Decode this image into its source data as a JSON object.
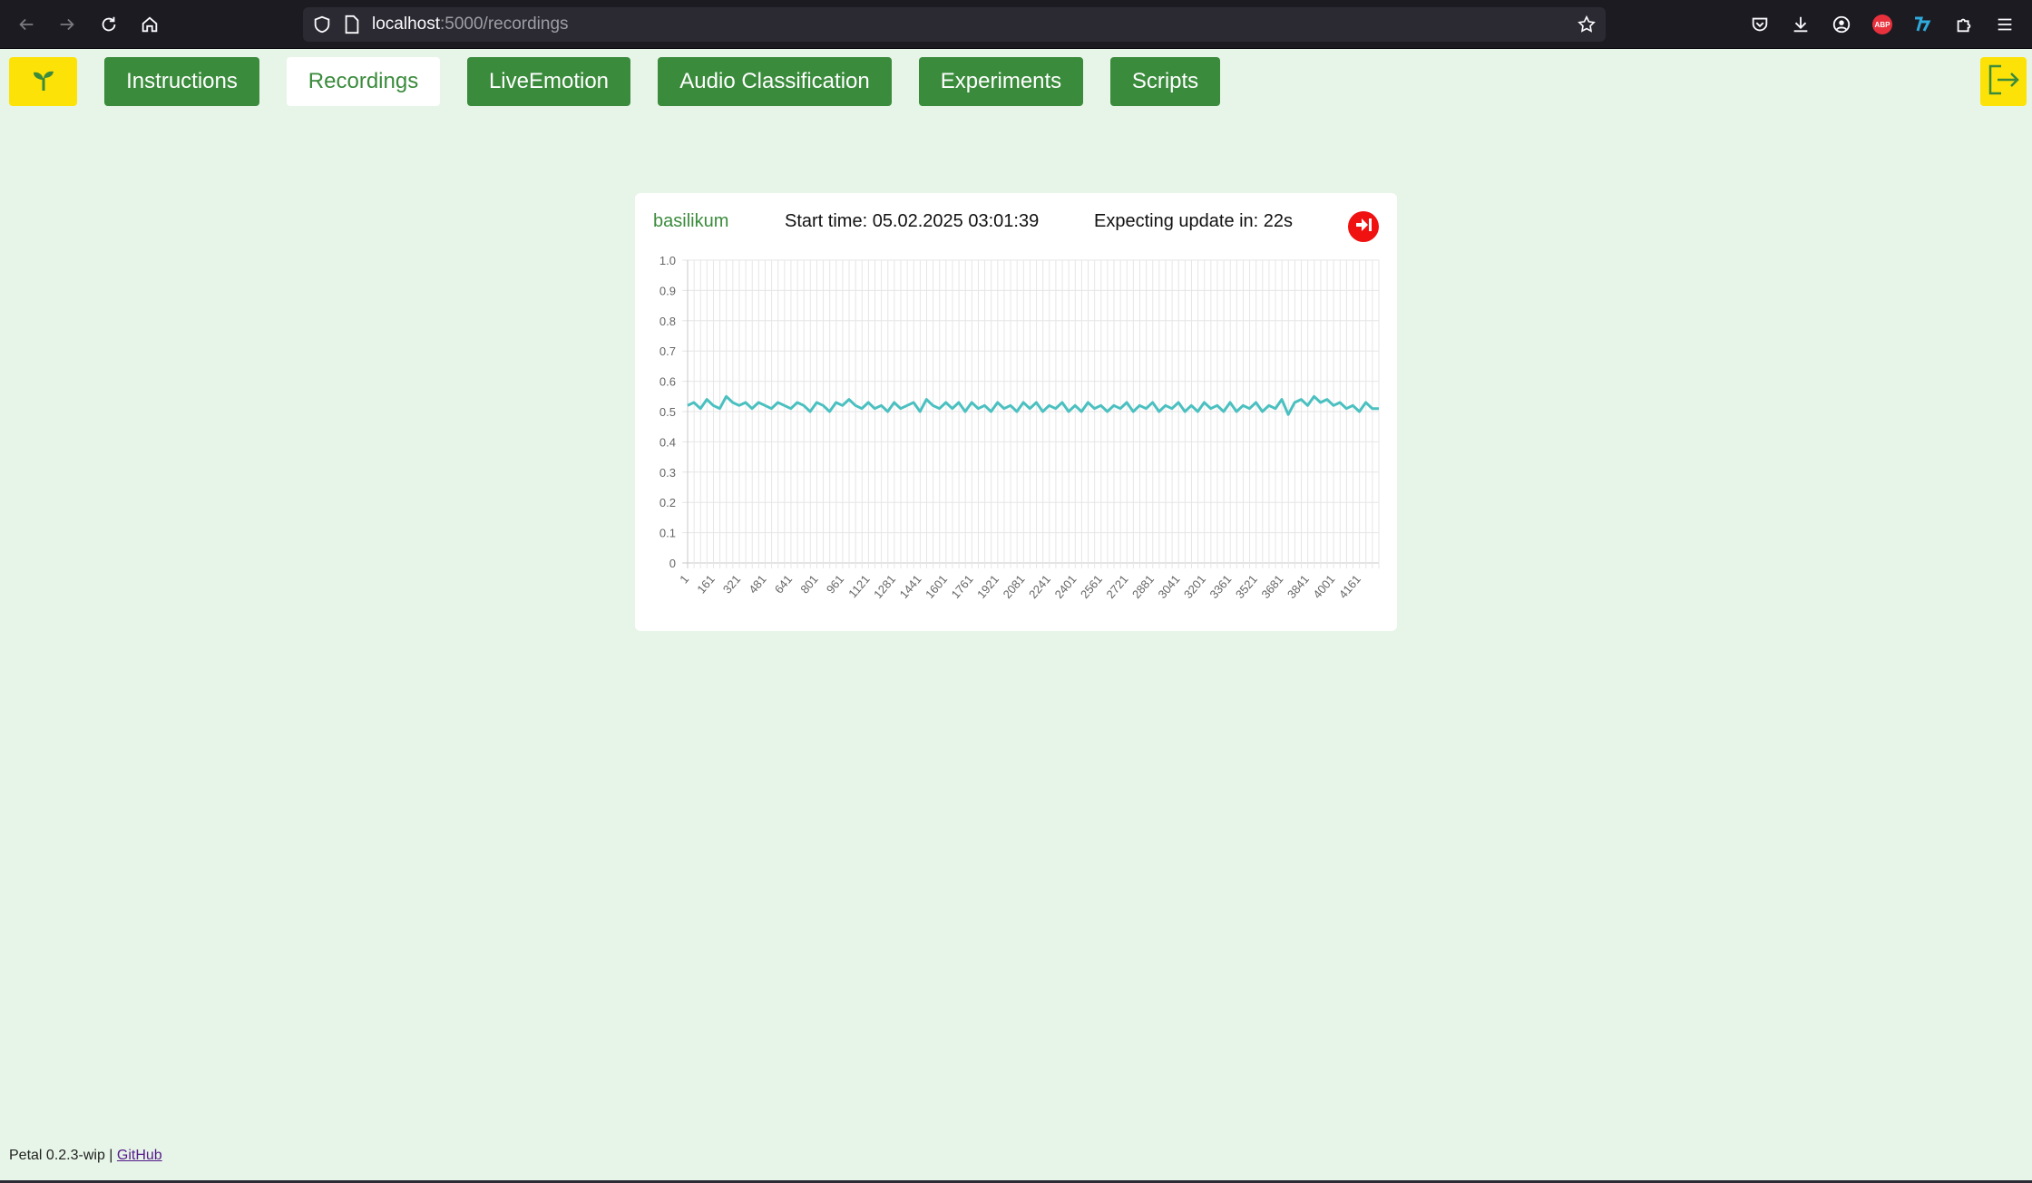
{
  "browser": {
    "url_host": "localhost",
    "url_rest": ":5000/recordings",
    "icons": [
      "back-arrow-icon",
      "forward-arrow-icon",
      "reload-icon",
      "home-icon",
      "shield-icon",
      "page-icon",
      "bookmark-star-icon",
      "pocket-icon",
      "download-icon",
      "account-icon",
      "adblock-icon",
      "extension-icon",
      "puzzle-icon",
      "menu-icon"
    ],
    "abp_label": "ABP"
  },
  "nav": {
    "home_icon": "sprout-icon",
    "tabs": [
      {
        "label": "Instructions",
        "active": false
      },
      {
        "label": "Recordings",
        "active": true
      },
      {
        "label": "LiveEmotion",
        "active": false
      },
      {
        "label": "Audio Classification",
        "active": false
      },
      {
        "label": "Experiments",
        "active": false
      },
      {
        "label": "Scripts",
        "active": false
      }
    ],
    "logout_icon": "logout-icon"
  },
  "recording": {
    "plant": "basilikum",
    "start_time": "Start time: 05.02.2025 03:01:39",
    "update": "Expecting update in: 22s",
    "stop_icon": "stop-recording-icon"
  },
  "chart_data": {
    "type": "line",
    "title": "",
    "xlabel": "",
    "ylabel": "",
    "ylim": [
      0,
      1.0
    ],
    "yticks": [
      "0",
      "0.1",
      "0.2",
      "0.3",
      "0.4",
      "0.5",
      "0.6",
      "0.7",
      "0.8",
      "0.9",
      "1.0"
    ],
    "xticks": [
      "1",
      "161",
      "321",
      "481",
      "641",
      "801",
      "961",
      "1121",
      "1281",
      "1441",
      "1601",
      "1761",
      "1921",
      "2081",
      "2241",
      "2401",
      "2561",
      "2721",
      "2881",
      "3041",
      "3201",
      "3361",
      "3521",
      "3681",
      "3841",
      "4001",
      "4161"
    ],
    "x_range": [
      1,
      4281
    ],
    "grid": true,
    "color": "#4bc0c0",
    "series": [
      {
        "x": [
          1,
          40,
          80,
          120,
          160,
          200,
          240,
          280,
          320,
          360,
          400,
          440,
          480,
          520,
          560,
          600,
          640,
          680,
          720,
          760,
          800,
          840,
          880,
          920,
          960,
          1000,
          1040,
          1080,
          1120,
          1160,
          1200,
          1240,
          1280,
          1320,
          1360,
          1400,
          1440,
          1480,
          1520,
          1560,
          1600,
          1640,
          1680,
          1720,
          1760,
          1800,
          1840,
          1880,
          1920,
          1960,
          2000,
          2040,
          2080,
          2120,
          2160,
          2200,
          2240,
          2280,
          2320,
          2360,
          2400,
          2440,
          2480,
          2520,
          2560,
          2600,
          2640,
          2680,
          2720,
          2760,
          2800,
          2840,
          2880,
          2920,
          2960,
          3000,
          3040,
          3080,
          3120,
          3160,
          3200,
          3240,
          3280,
          3320,
          3360,
          3400,
          3440,
          3480,
          3520,
          3560,
          3600,
          3640,
          3680,
          3720,
          3760,
          3800,
          3840,
          3880,
          3920,
          3960,
          4000,
          4040,
          4080,
          4120,
          4160,
          4200,
          4240,
          4281
        ],
        "values": [
          0.52,
          0.53,
          0.51,
          0.54,
          0.52,
          0.51,
          0.55,
          0.53,
          0.52,
          0.53,
          0.51,
          0.53,
          0.52,
          0.51,
          0.53,
          0.52,
          0.51,
          0.53,
          0.52,
          0.5,
          0.53,
          0.52,
          0.5,
          0.53,
          0.52,
          0.54,
          0.52,
          0.51,
          0.53,
          0.51,
          0.52,
          0.5,
          0.53,
          0.51,
          0.52,
          0.53,
          0.5,
          0.54,
          0.52,
          0.51,
          0.53,
          0.51,
          0.53,
          0.5,
          0.53,
          0.51,
          0.52,
          0.5,
          0.53,
          0.51,
          0.52,
          0.5,
          0.53,
          0.51,
          0.53,
          0.5,
          0.52,
          0.51,
          0.53,
          0.5,
          0.52,
          0.5,
          0.53,
          0.51,
          0.52,
          0.5,
          0.52,
          0.51,
          0.53,
          0.5,
          0.52,
          0.51,
          0.53,
          0.5,
          0.52,
          0.51,
          0.53,
          0.5,
          0.52,
          0.5,
          0.53,
          0.51,
          0.52,
          0.5,
          0.53,
          0.5,
          0.52,
          0.51,
          0.53,
          0.5,
          0.52,
          0.51,
          0.54,
          0.49,
          0.53,
          0.54,
          0.52,
          0.55,
          0.53,
          0.54,
          0.52,
          0.53,
          0.51,
          0.52,
          0.5,
          0.53,
          0.51,
          0.51
        ]
      }
    ]
  },
  "footer": {
    "text": "Petal 0.2.3-wip | ",
    "link": "GitHub"
  }
}
